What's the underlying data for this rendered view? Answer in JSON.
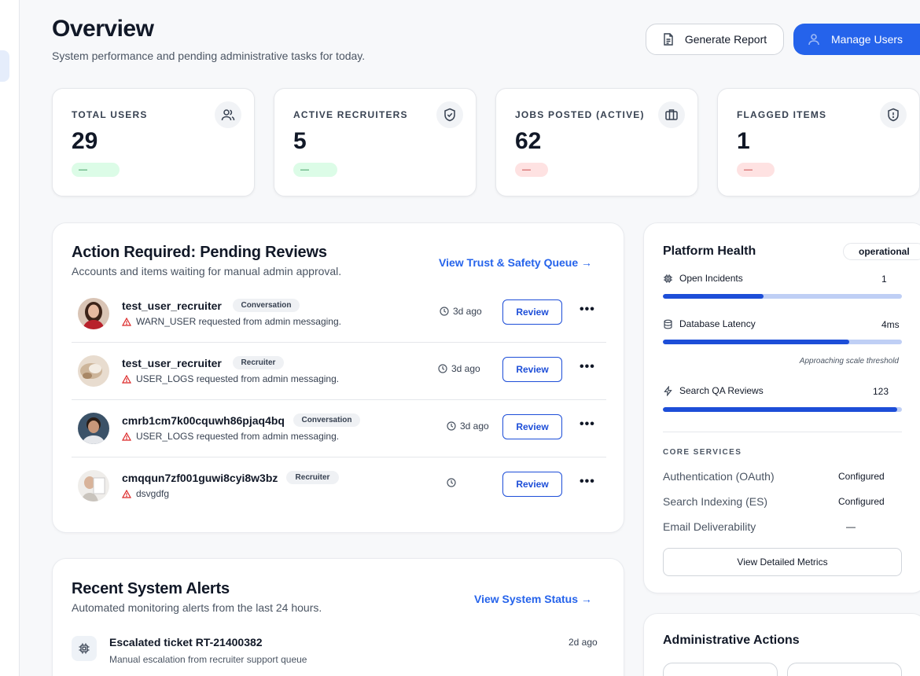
{
  "header": {
    "title": "Overview",
    "subtitle": "System performance and pending administrative tasks for today.",
    "generate_report_label": "Generate Report",
    "manage_users_label": "Manage Users"
  },
  "stats": [
    {
      "label": "TOTAL USERS",
      "value": "29",
      "badge": "—",
      "badge_tone": "green",
      "icon": "users-icon"
    },
    {
      "label": "ACTIVE RECRUITERS",
      "value": "5",
      "badge": "—",
      "badge_tone": "green",
      "icon": "shield-check-icon"
    },
    {
      "label": "JOBS POSTED (ACTIVE)",
      "value": "62",
      "badge": "—",
      "badge_tone": "red",
      "icon": "briefcase-icon"
    },
    {
      "label": "FLAGGED ITEMS",
      "value": "1",
      "badge": "—",
      "badge_tone": "red",
      "icon": "shield-alert-icon"
    }
  ],
  "pending": {
    "title": "Action Required: Pending Reviews",
    "subtitle": "Accounts and items waiting for manual admin approval.",
    "link": "View Trust & Safety Queue →",
    "review_label": "Review",
    "more_label": "•••",
    "rows": [
      {
        "name": "test_user_recruiter",
        "tag": "Conversation",
        "message": "WARN_USER requested from admin messaging.",
        "time": "3d ago"
      },
      {
        "name": "test_user_recruiter",
        "tag": "Recruiter",
        "message": "USER_LOGS requested from admin messaging.",
        "time": "3d ago"
      },
      {
        "name": "cmrb1cm7k00cquwh86pjaq4bq",
        "tag": "Conversation",
        "message": "USER_LOGS requested from admin messaging.",
        "time": "3d ago"
      },
      {
        "name": "cmqqun7zf001guwi8cyi8w3bz",
        "tag": "Recruiter",
        "message": "dsvgdfg",
        "time": ""
      }
    ]
  },
  "alerts": {
    "title": "Recent System Alerts",
    "subtitle": "Automated monitoring alerts from the last 24 hours.",
    "link": "View System Status →",
    "items": [
      {
        "title": "Escalated ticket RT-21400382",
        "description": "Manual escalation from recruiter support queue",
        "time": "2d ago"
      }
    ]
  },
  "health": {
    "title": "Platform Health",
    "status": "operational",
    "metrics": [
      {
        "label": "Open Incidents",
        "value": "1",
        "fill": 0.42,
        "icon": "cpu-icon"
      },
      {
        "label": "Database Latency",
        "value": "4ms",
        "fill": 0.78,
        "icon": "database-icon"
      },
      {
        "label": "Search QA Reviews",
        "value": "123",
        "fill": 0.98,
        "icon": "lightning-icon"
      }
    ],
    "note": "Approaching scale threshold",
    "core_label": "CORE SERVICES",
    "services": [
      {
        "name": "Authentication (OAuth)",
        "status": "Configured"
      },
      {
        "name": "Search Indexing (ES)",
        "status": "Configured"
      },
      {
        "name": "Email Deliverability",
        "status": "—"
      }
    ],
    "detail_button": "View Detailed Metrics"
  },
  "admin": {
    "title": "Administrative Actions"
  },
  "colors": {
    "accent": "#2563eb",
    "success_bg": "#dcfce7",
    "danger_bg": "#fee2e2",
    "bar_track": "#bfcff5",
    "bar_fill": "#1d4ed8"
  }
}
